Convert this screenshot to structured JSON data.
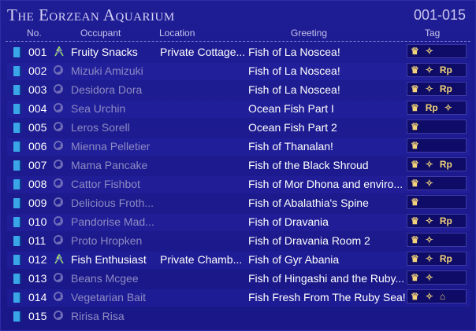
{
  "header": {
    "title": "The Eorzean Aquarium",
    "range": "001-015"
  },
  "columns": {
    "no": "No.",
    "occupant": "Occupant",
    "location": "Location",
    "greeting": "Greeting",
    "tag": "Tag"
  },
  "rows": [
    {
      "no": "001",
      "occupant": "Fruity Snacks",
      "location": "Private Cottage...",
      "greeting": "Fish of La Noscea!",
      "online": true,
      "tags": [
        "house",
        "emote"
      ]
    },
    {
      "no": "002",
      "occupant": "Mizuki Amizuki",
      "location": "",
      "greeting": "Fish of La Noscea!",
      "online": false,
      "tags": [
        "house",
        "emote",
        "rp"
      ]
    },
    {
      "no": "003",
      "occupant": "Desidora Dora",
      "location": "",
      "greeting": "Fish of La Noscea!",
      "online": false,
      "tags": [
        "house",
        "emote",
        "rp"
      ]
    },
    {
      "no": "004",
      "occupant": "Sea Urchin",
      "location": "",
      "greeting": "Ocean Fish Part I",
      "online": false,
      "tags": [
        "house",
        "rp",
        "emote"
      ]
    },
    {
      "no": "005",
      "occupant": "Leros Sorell",
      "location": "",
      "greeting": "Ocean Fish Part 2",
      "online": false,
      "tags": [
        "house"
      ]
    },
    {
      "no": "006",
      "occupant": "Mienna Pelletier",
      "location": "",
      "greeting": "Fish of Thanalan!",
      "online": false,
      "tags": [
        "house"
      ]
    },
    {
      "no": "007",
      "occupant": "Mama Pancake",
      "location": "",
      "greeting": "Fish of the Black Shroud",
      "online": false,
      "tags": [
        "house",
        "emote",
        "rp"
      ]
    },
    {
      "no": "008",
      "occupant": "Cattor Fishbot",
      "location": "",
      "greeting": "Fish of Mor Dhona and enviro...",
      "online": false,
      "tags": [
        "house",
        "emote"
      ]
    },
    {
      "no": "009",
      "occupant": "Delicious Froth...",
      "location": "",
      "greeting": "Fish of Abalathia's Spine",
      "online": false,
      "tags": [
        "house"
      ]
    },
    {
      "no": "010",
      "occupant": "Pandorise Mad...",
      "location": "",
      "greeting": "Fish of Dravania",
      "online": false,
      "tags": [
        "house",
        "emote",
        "rp"
      ]
    },
    {
      "no": "011",
      "occupant": "Proto Hropken",
      "location": "",
      "greeting": "Fish of Dravania Room 2",
      "online": false,
      "tags": [
        "house",
        "emote"
      ]
    },
    {
      "no": "012",
      "occupant": "Fish Enthusiast",
      "location": "Private Chamb...",
      "greeting": "Fish of Gyr Abania",
      "online": true,
      "tags": [
        "house",
        "emote",
        "rp"
      ]
    },
    {
      "no": "013",
      "occupant": "Beans Mcgee",
      "location": "",
      "greeting": "Fish of Hingashi and the Ruby...",
      "online": false,
      "tags": [
        "house",
        "emote"
      ]
    },
    {
      "no": "014",
      "occupant": "Vegetarian Bait",
      "location": "",
      "greeting": "Fish Fresh From The Ruby Sea!",
      "online": false,
      "tags": [
        "house",
        "emote",
        "home"
      ]
    },
    {
      "no": "015",
      "occupant": "Ririsa Risa",
      "location": "",
      "greeting": "",
      "online": false,
      "tags": []
    }
  ],
  "tag_glyphs": {
    "house": "♛",
    "emote": "✧",
    "rp": "Rp",
    "home": "⌂"
  },
  "colors": {
    "background": "#1c1a8c",
    "tag_gold": "#f2d27a",
    "dim_text": "#8e8bc4"
  }
}
